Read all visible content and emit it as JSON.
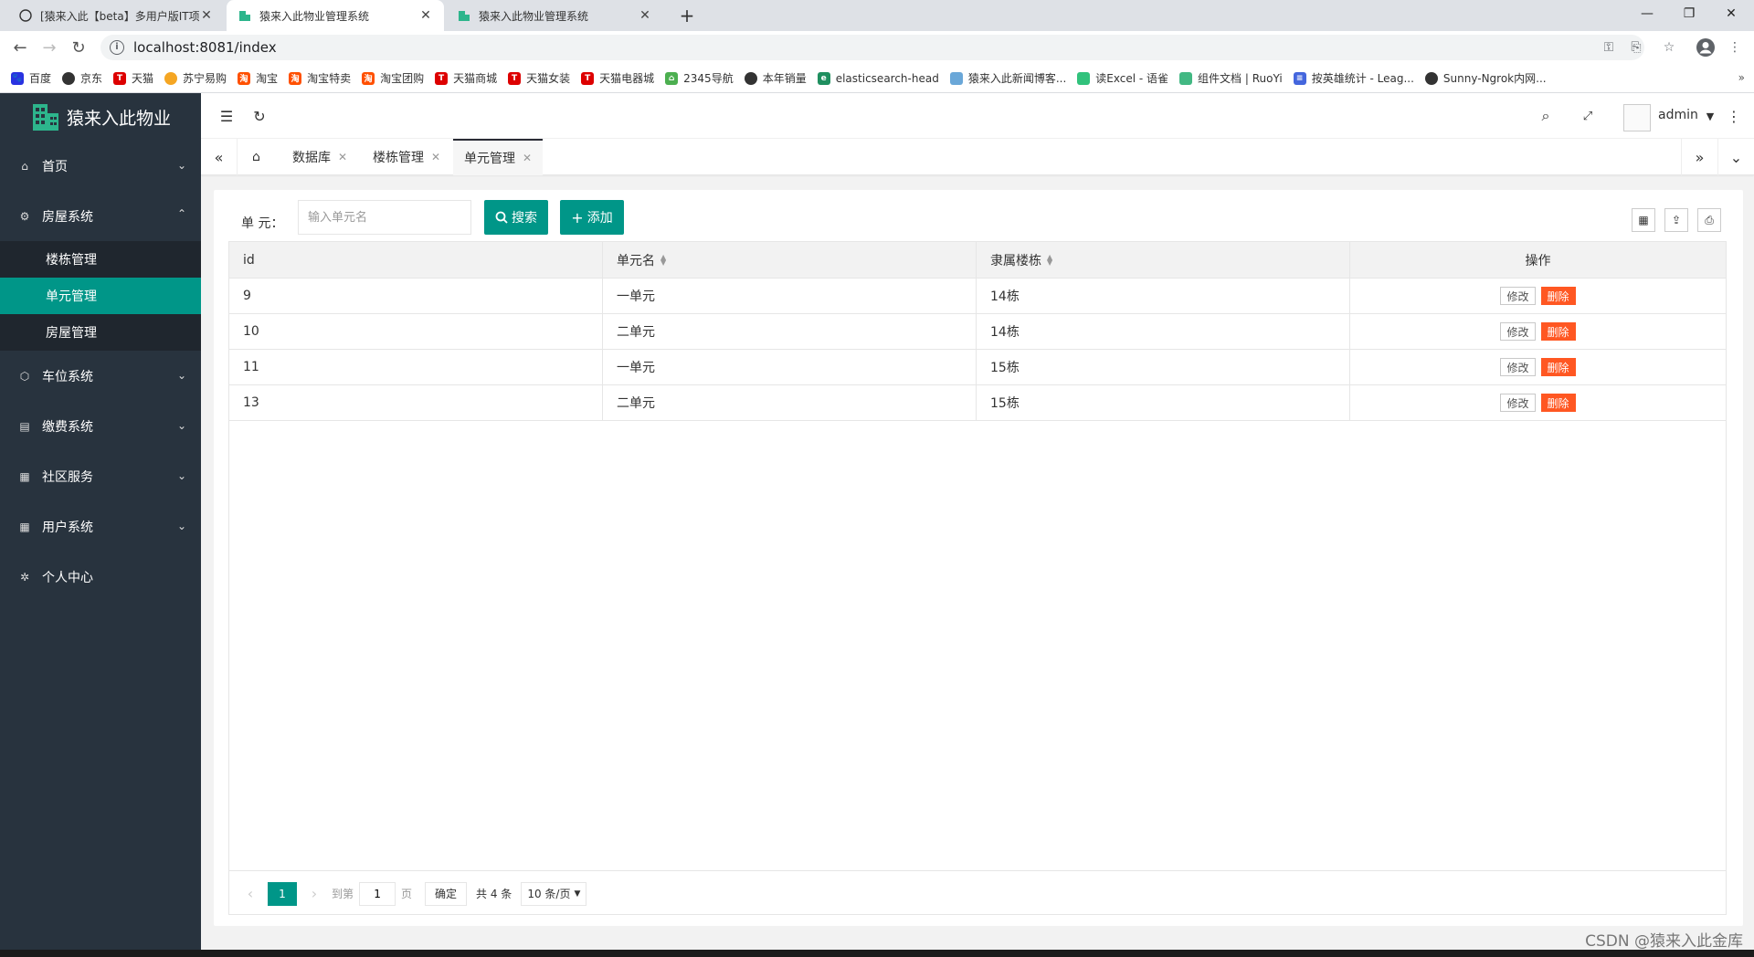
{
  "browser": {
    "tabs": [
      {
        "title": "[猿来入此【beta】多用户版IT项",
        "active": false
      },
      {
        "title": "猿来入此物业管理系统",
        "active": true
      },
      {
        "title": "猿来入此物业管理系统",
        "active": false
      }
    ],
    "url": "localhost:8081/index",
    "bookmarks": [
      "百度",
      "京东",
      "天猫",
      "苏宁易购",
      "淘宝",
      "淘宝特卖",
      "淘宝团购",
      "天猫商城",
      "天猫女装",
      "天猫电器城",
      "2345导航",
      "本年销量",
      "elasticsearch-head",
      "猿来入此新闻博客...",
      "读Excel - 语雀",
      "组件文档 | RuoYi",
      "按英雄统计 - Leag...",
      "Sunny-Ngrok内网..."
    ]
  },
  "app": {
    "logo_text": "猿来入此物业",
    "menu": [
      {
        "label": "首页",
        "icon": "home-icon",
        "expanded": false
      },
      {
        "label": "房屋系统",
        "icon": "gear-icon",
        "expanded": true,
        "children": [
          {
            "label": "楼栋管理",
            "active": false
          },
          {
            "label": "单元管理",
            "active": true
          },
          {
            "label": "房屋管理",
            "active": false
          }
        ]
      },
      {
        "label": "车位系统",
        "icon": "cube-icon",
        "expanded": false
      },
      {
        "label": "缴费系统",
        "icon": "book-icon",
        "expanded": false
      },
      {
        "label": "社区服务",
        "icon": "apps-icon",
        "expanded": false
      },
      {
        "label": "用户系统",
        "icon": "apps-icon",
        "expanded": false
      },
      {
        "label": "个人中心",
        "icon": "settings-icon",
        "expanded": false
      }
    ],
    "user": "admin",
    "page_tabs": [
      {
        "label": "数据库",
        "active": false
      },
      {
        "label": "楼栋管理",
        "active": false
      },
      {
        "label": "单元管理",
        "active": true
      }
    ]
  },
  "search": {
    "label": "单 元：",
    "placeholder": "输入单元名",
    "search_btn": "搜索",
    "add_btn": "添加"
  },
  "table": {
    "columns": [
      "id",
      "单元名",
      "隶属楼栋",
      "操作"
    ],
    "rows": [
      {
        "id": "9",
        "name": "一单元",
        "building": "14栋"
      },
      {
        "id": "10",
        "name": "二单元",
        "building": "14栋"
      },
      {
        "id": "11",
        "name": "一单元",
        "building": "15栋"
      },
      {
        "id": "13",
        "name": "二单元",
        "building": "15栋"
      }
    ],
    "edit_label": "修改",
    "delete_label": "删除"
  },
  "pager": {
    "current": "1",
    "goto_label": "到第",
    "page_input": "1",
    "page_unit": "页",
    "ok": "确定",
    "total": "共 4 条",
    "per_page": "10 条/页"
  },
  "watermark": "CSDN @猿来入此金库",
  "colors": {
    "primary": "#009688",
    "danger": "#ff5722",
    "sidebar": "#28333e"
  }
}
